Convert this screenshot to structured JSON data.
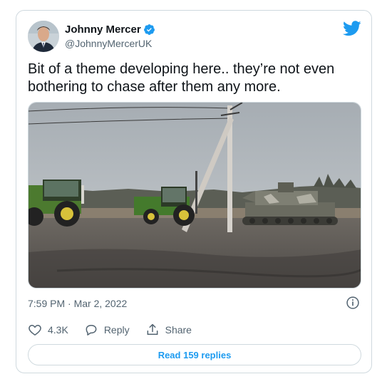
{
  "tweet": {
    "author_name": "Johnny Mercer",
    "author_handle": "@JohnnyMercerUK",
    "text": "Bit of a theme developing here.. they’re not even bothering to chase after them any more.",
    "timestamp": "7:59 PM · Mar 2, 2022",
    "likes": "4.3K",
    "reply_label": "Reply",
    "share_label": "Share",
    "read_replies_label": "Read 159 replies"
  },
  "icons": {
    "verified": "verified-badge-icon",
    "brand": "twitter-bird-icon",
    "info": "info-icon",
    "like": "heart-icon",
    "reply": "speech-bubble-icon",
    "share": "share-upload-icon"
  },
  "colors": {
    "accent": "#1d9bf0",
    "text_primary": "#0f1419",
    "text_secondary": "#536471",
    "border": "#cfd9de"
  }
}
